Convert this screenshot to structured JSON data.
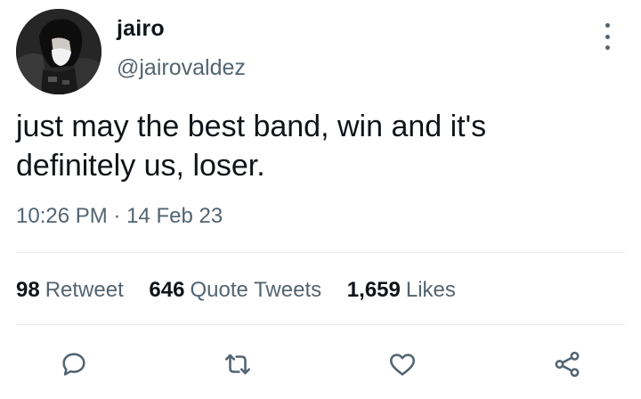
{
  "user": {
    "display_name": "jairo",
    "handle": "@jairovaldez",
    "avatar_icon": "avatar-photo"
  },
  "tweet": {
    "text_lines": [
      "just may the best band, win and it's",
      "definitely us, loser."
    ],
    "time": "10:26 PM",
    "separator": "·",
    "date": "14 Feb 23"
  },
  "stats": {
    "retweets": {
      "count": "98",
      "label": "Retweet"
    },
    "quotes": {
      "count": "646",
      "label": "Quote Tweets"
    },
    "likes": {
      "count": "1,659",
      "label": "Likes"
    }
  },
  "actions": {
    "reply_icon": "reply-icon",
    "retweet_icon": "retweet-icon",
    "like_icon": "heart-icon",
    "share_icon": "share-icon"
  },
  "colors": {
    "text": "#0f1419",
    "secondary": "#536471",
    "divider": "#e6ecf0"
  }
}
